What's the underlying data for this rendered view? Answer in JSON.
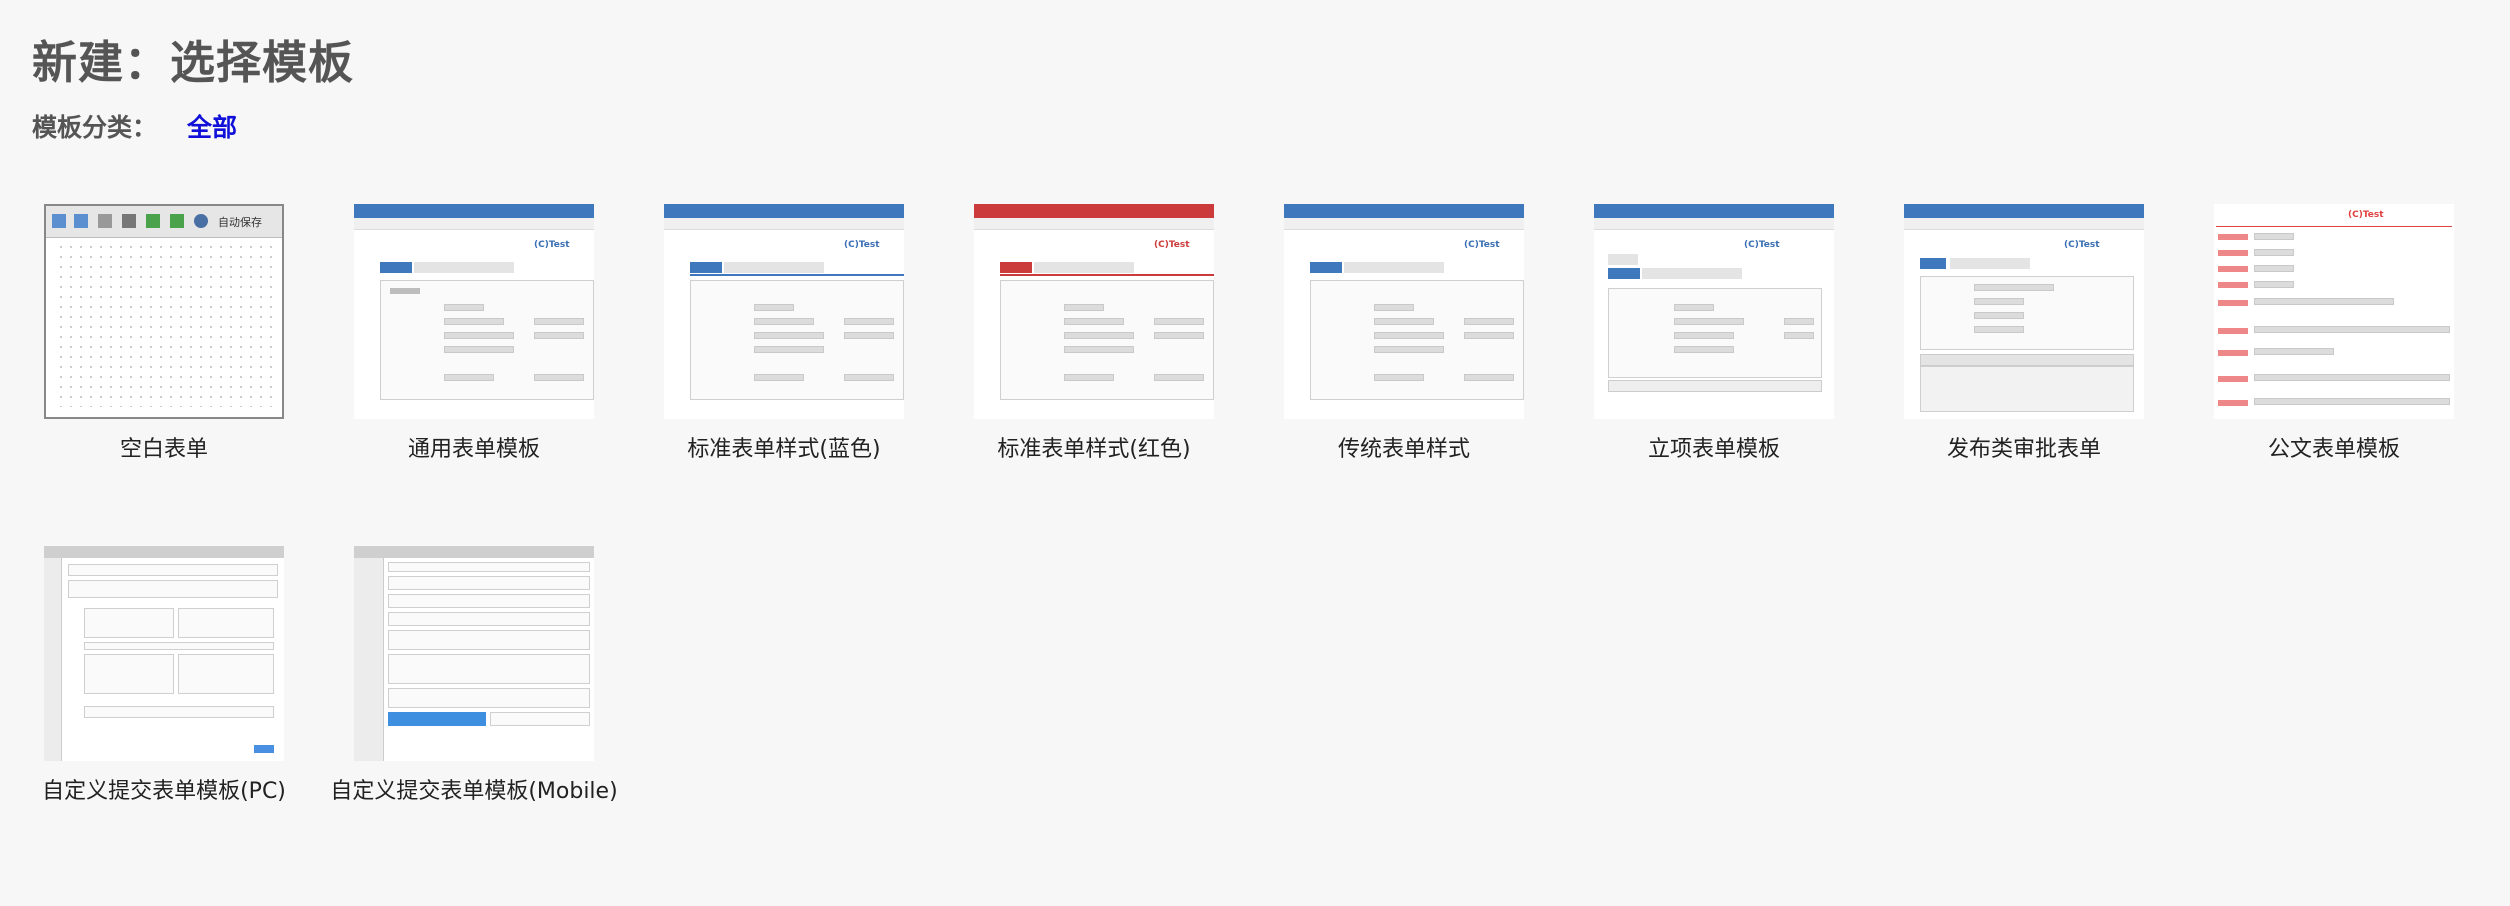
{
  "page": {
    "title": "新建：选择模板",
    "category_label": "模板分类：",
    "category_all": "全部"
  },
  "blank_toolbar_label": "自动保存",
  "mock_title": "(C)Test",
  "colors": {
    "accent_blue": "#3f78bd",
    "accent_red": "#cc3b3b",
    "category_link": "#1010d8"
  },
  "templates": [
    {
      "label": "空白表单"
    },
    {
      "label": "通用表单模板"
    },
    {
      "label": "标准表单样式(蓝色)"
    },
    {
      "label": "标准表单样式(红色)"
    },
    {
      "label": "传统表单样式"
    },
    {
      "label": "立项表单模板"
    },
    {
      "label": "发布类审批表单"
    },
    {
      "label": "公文表单模板"
    },
    {
      "label": "自定义提交表单模板(PC)"
    },
    {
      "label": "自定义提交表单模板(Mobile)"
    }
  ]
}
